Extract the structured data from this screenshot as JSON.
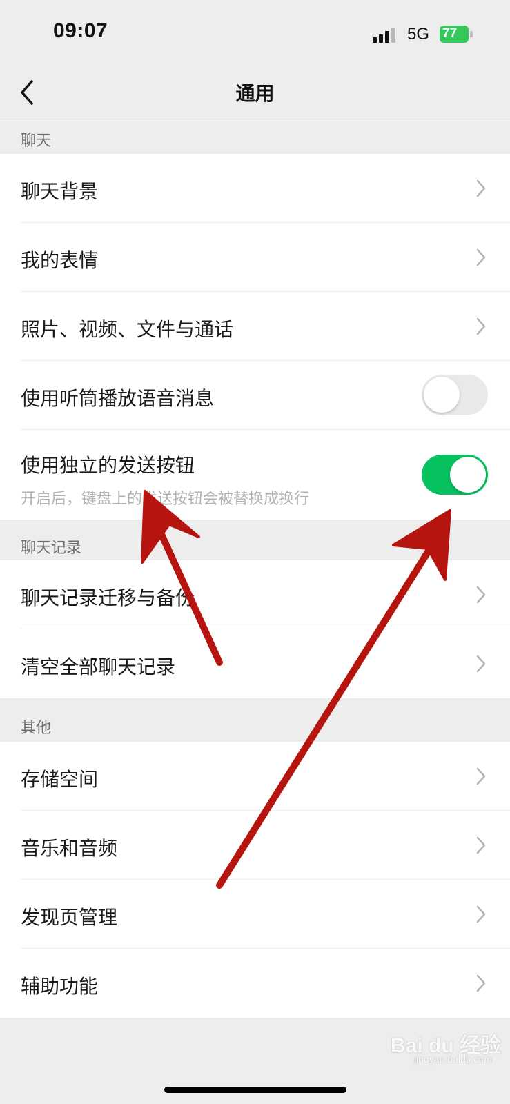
{
  "status_bar": {
    "time": "09:07",
    "network": "5G",
    "battery": "77"
  },
  "nav": {
    "title": "通用",
    "back_icon": "chevron-left-icon"
  },
  "sections": [
    {
      "header": "聊天",
      "rows": [
        {
          "label": "聊天背景"
        },
        {
          "label": "我的表情"
        },
        {
          "label": "照片、视频、文件与通话"
        },
        {
          "label": "使用听筒播放语音消息",
          "toggle": false
        },
        {
          "label": "使用独立的发送按钮",
          "sublabel": "开启后，键盘上的发送按钮会被替换成换行",
          "toggle": true
        }
      ]
    },
    {
      "header": "聊天记录",
      "rows": [
        {
          "label": "聊天记录迁移与备份"
        },
        {
          "label": "清空全部聊天记录"
        }
      ]
    },
    {
      "header": "其他",
      "rows": [
        {
          "label": "存储空间"
        },
        {
          "label": "音乐和音频"
        },
        {
          "label": "发现页管理"
        },
        {
          "label": "辅助功能"
        }
      ]
    }
  ],
  "watermark": {
    "brand": "Bai du 经验",
    "url": "jingyan.baidu.com"
  },
  "colors": {
    "toggle_on": "#07c160",
    "annotation_arrow": "#b5140f",
    "background": "#ededed"
  }
}
